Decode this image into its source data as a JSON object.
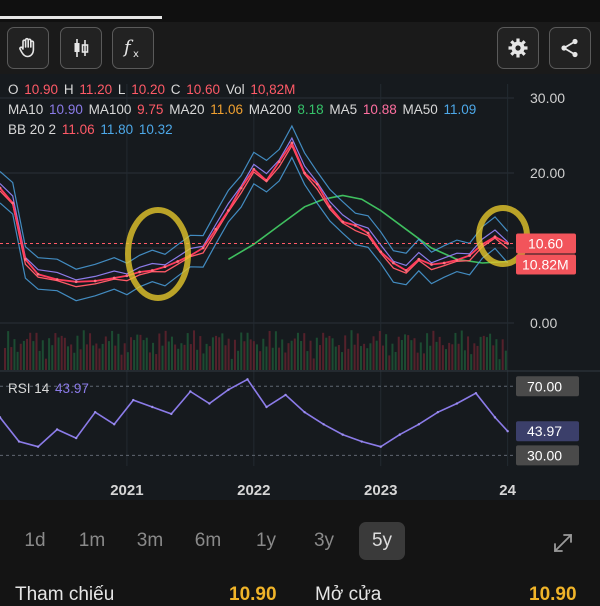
{
  "toolbar": {
    "buttons": [
      "hand-tool",
      "candlestick-type",
      "indicator-fx",
      "settings",
      "share"
    ]
  },
  "legend": {
    "ohlc": [
      {
        "label": "O",
        "value": "10.90",
        "color": "#ff5a67"
      },
      {
        "label": "H",
        "value": "11.20",
        "color": "#ff5a67"
      },
      {
        "label": "L",
        "value": "10.20",
        "color": "#ff5a67"
      },
      {
        "label": "C",
        "value": "10.60",
        "color": "#ff5a67"
      },
      {
        "label": "Vol",
        "value": "10,82M",
        "color": "#ff5a67"
      }
    ],
    "ma": [
      {
        "label": "MA10",
        "value": "10.90",
        "color": "#8b7be8"
      },
      {
        "label": "MA100",
        "value": "9.75",
        "color": "#ff5a67"
      },
      {
        "label": "MA20",
        "value": "11.06",
        "color": "#f0a030"
      },
      {
        "label": "MA200",
        "value": "8.18",
        "color": "#36c26a"
      },
      {
        "label": "MA5",
        "value": "10.88",
        "color": "#ff6fa0"
      },
      {
        "label": "MA50",
        "value": "11.09",
        "color": "#4da8e8"
      }
    ],
    "bb": {
      "label": "BB 20 2",
      "values": [
        {
          "value": "11.06",
          "color": "#ff5a67"
        },
        {
          "value": "11.80",
          "color": "#4da8e8"
        },
        {
          "value": "10.32",
          "color": "#4da8e8"
        }
      ]
    }
  },
  "rsi": {
    "label": "RSI 14",
    "value": "43.97",
    "color": "#8b7be8"
  },
  "price_axis": [
    "30.00",
    "20.00",
    "10.00",
    "0.00"
  ],
  "rsi_axis": [
    "70.00",
    "43.97",
    "30.00"
  ],
  "last_price_tag": "10.60",
  "last_volume_tag": "10.82M",
  "periods": [
    "1d",
    "1m",
    "3m",
    "6m",
    "1y",
    "3y",
    "5y"
  ],
  "active_period": "5y",
  "footer": {
    "ref_label": "Tham chiếu",
    "ref_value": "10.90",
    "open_label": "Mở cửa",
    "open_value": "10.90"
  },
  "chart_data": {
    "type": "line",
    "x_ticks": [
      "2021",
      "2022",
      "2023",
      "24"
    ],
    "price": {
      "x": [
        2020.0,
        2020.1,
        2020.2,
        2020.3,
        2020.45,
        2020.6,
        2020.75,
        2020.9,
        2021.0,
        2021.1,
        2021.2,
        2021.3,
        2021.4,
        2021.5,
        2021.6,
        2021.7,
        2021.8,
        2021.9,
        2022.0,
        2022.1,
        2022.2,
        2022.3,
        2022.4,
        2022.5,
        2022.6,
        2022.7,
        2022.8,
        2022.9,
        2023.0,
        2023.1,
        2023.2,
        2023.3,
        2023.4,
        2023.5,
        2023.6,
        2023.7,
        2023.8,
        2023.9,
        2024.0
      ],
      "close": [
        18.0,
        16.0,
        8.5,
        6.5,
        5.8,
        5.5,
        5.6,
        6.0,
        6.3,
        6.8,
        7.0,
        7.5,
        8.2,
        9.0,
        10.0,
        12.5,
        15.0,
        18.0,
        20.5,
        19.0,
        21.5,
        24.0,
        20.0,
        18.5,
        15.5,
        13.5,
        13.0,
        12.0,
        9.5,
        8.0,
        7.0,
        8.5,
        7.8,
        8.0,
        8.4,
        9.0,
        10.5,
        11.5,
        10.6
      ]
    },
    "ma200": {
      "x": [
        2021.8,
        2022.0,
        2022.2,
        2022.4,
        2022.55,
        2022.7,
        2022.85,
        2023.0,
        2023.2,
        2023.4,
        2023.6,
        2023.8,
        2024.0
      ],
      "values": [
        8.5,
        10.5,
        13.0,
        15.5,
        16.5,
        17.0,
        16.5,
        15.0,
        12.5,
        10.0,
        8.5,
        8.0,
        8.2
      ]
    },
    "rsi": {
      "x": [
        2020.0,
        2020.15,
        2020.3,
        2020.45,
        2020.6,
        2020.75,
        2020.9,
        2021.05,
        2021.2,
        2021.35,
        2021.5,
        2021.65,
        2021.8,
        2021.95,
        2022.1,
        2022.25,
        2022.4,
        2022.55,
        2022.7,
        2022.85,
        2023.0,
        2023.15,
        2023.3,
        2023.45,
        2023.6,
        2023.75,
        2023.9,
        2024.0
      ],
      "values": [
        52,
        38,
        35,
        45,
        40,
        55,
        48,
        62,
        58,
        54,
        67,
        60,
        68,
        74,
        58,
        65,
        55,
        48,
        42,
        38,
        35,
        42,
        48,
        55,
        60,
        66,
        52,
        43.97
      ]
    },
    "price_ylim": [
      0,
      30
    ],
    "rsi_ylim": [
      25,
      80
    ],
    "last_price": 10.6
  }
}
